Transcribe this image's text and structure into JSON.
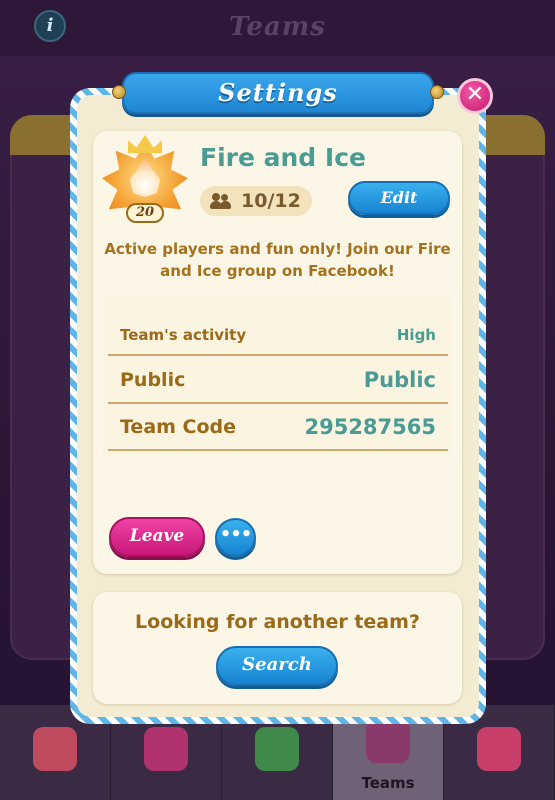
{
  "background": {
    "screen_title": "Teams",
    "info_icon": "info-icon",
    "tabs": [
      {
        "label": "",
        "icon": "shop-icon"
      },
      {
        "label": "",
        "icon": "friends-icon"
      },
      {
        "label": "",
        "icon": "events-icon"
      },
      {
        "label": "Teams",
        "icon": "teams-icon"
      },
      {
        "label": "",
        "icon": "tasks-icon"
      }
    ]
  },
  "modal": {
    "title": "Settings",
    "close_icon": "close-icon"
  },
  "team": {
    "name": "Fire and Ice",
    "badge_level": "20",
    "members": "10/12",
    "edit_label": "Edit",
    "description": "Active players and fun only! Join our Fire and Ice group on Facebook!"
  },
  "stats": [
    {
      "label": "Team's activity",
      "value": "High"
    },
    {
      "label": "Public",
      "value": "Public"
    },
    {
      "label": "Team Code",
      "value": "295287565"
    }
  ],
  "actions": {
    "leave_label": "Leave",
    "more_label": "•••"
  },
  "search_section": {
    "prompt": "Looking for another team?",
    "search_label": "Search"
  },
  "colors": {
    "accent_teal": "#4a9b94",
    "brown_text": "#9b6a19",
    "blue_button": "#1f86d4",
    "pink_button": "#c9167a",
    "card_bg": "#fbf6e6"
  }
}
